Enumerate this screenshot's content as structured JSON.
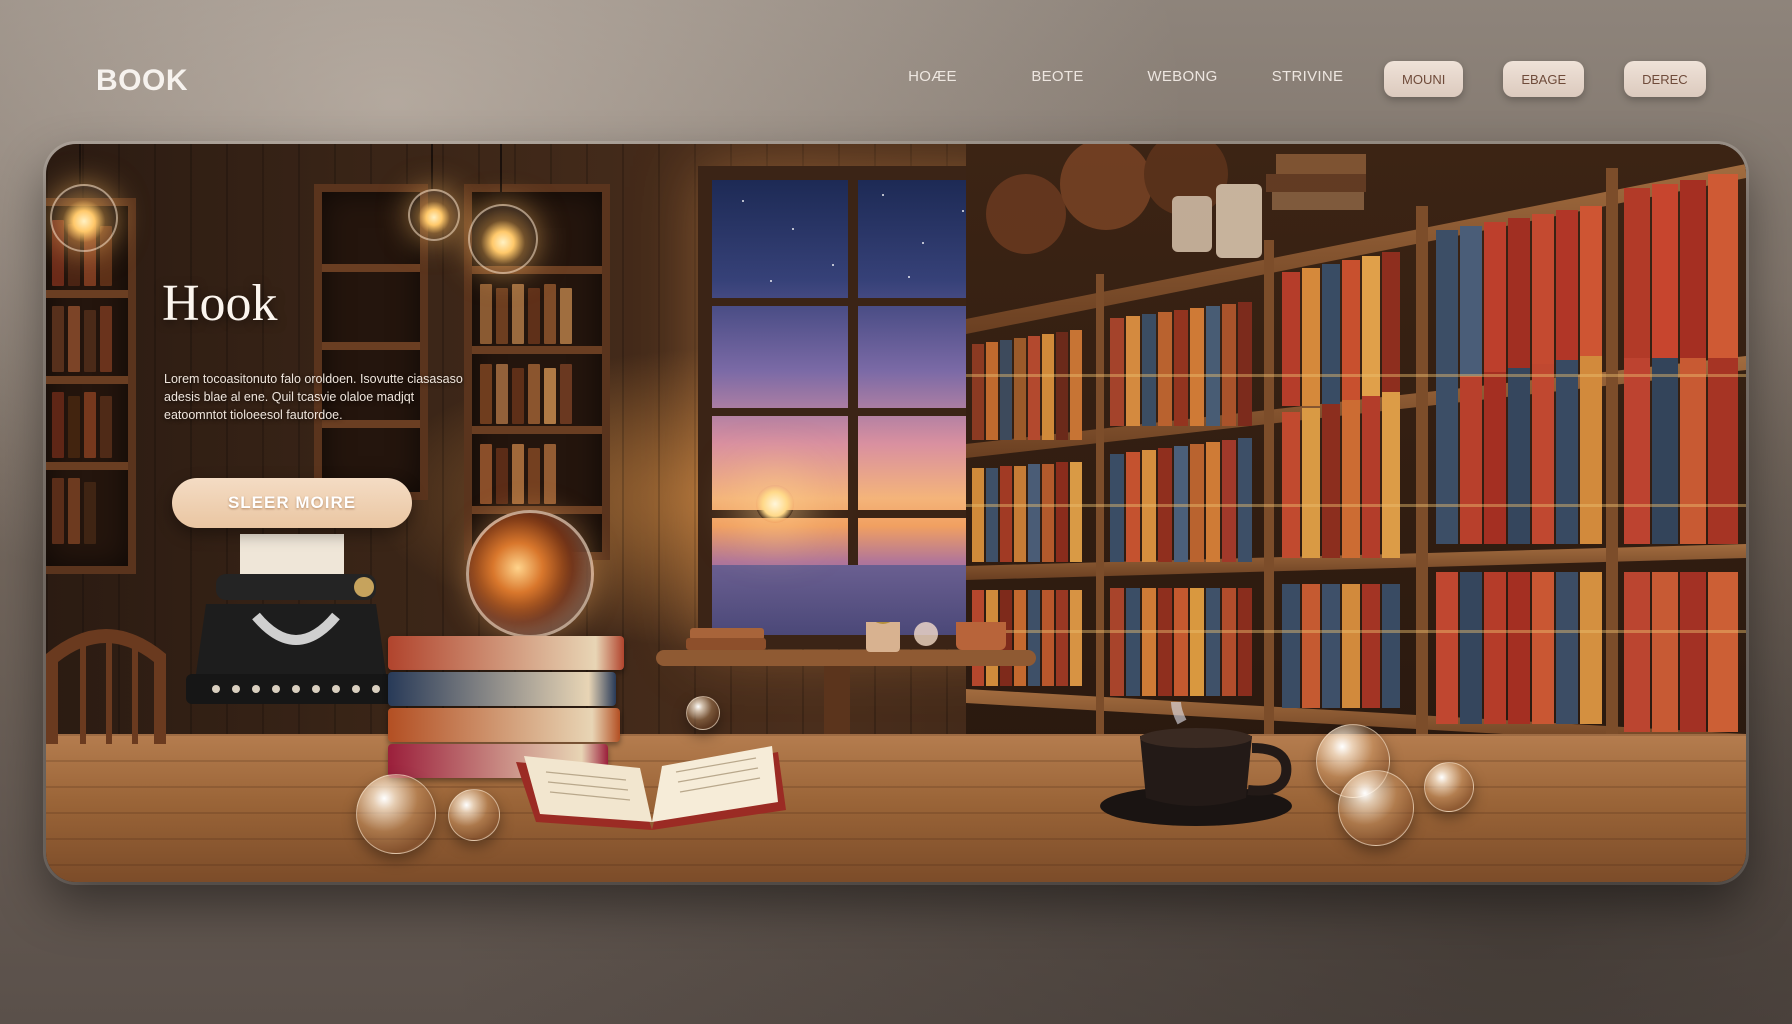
{
  "nav": {
    "brand": "BOOK",
    "links": [
      "HOÆE",
      "BEOTE",
      "WEBONG",
      "STRIVINE"
    ],
    "buttons": [
      "MOUNI",
      "EBAGE",
      "DEREC"
    ]
  },
  "hero": {
    "title": "Hook",
    "body": "Lorem tocoasitonuto falo oroldoen. Isovutte ciasasaso adesis blae al ene. Quil tcasvie olaloe madjqt eatoomntot tioloeesol fautordoe.",
    "cta": "SLEER MOIRE"
  },
  "colors": {
    "background": "#75695f",
    "nav_button_bg": "#e8d6ca",
    "nav_button_text": "#6f4b3a",
    "cta_bg": "#efd2b4",
    "wood": "#9b6538"
  },
  "icons": {
    "lamps": "pendant-bulb-icon",
    "typewriter": "typewriter-icon",
    "globe": "globe-icon",
    "coffee": "coffee-cup-icon"
  }
}
